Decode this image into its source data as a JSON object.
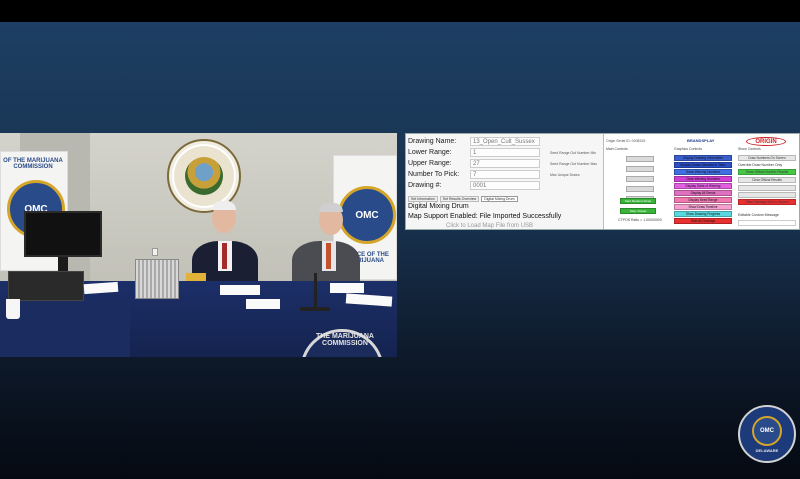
{
  "video": {
    "banner_left_label": "OMC",
    "banner_left_text": "OF THE MARIJUANA COMMISSION",
    "banner_right_label": "OMC",
    "banner_right_text": "OFFICE OF THE MARIJUANA",
    "skirt_text": "THE MARIJUANA COMMISSION"
  },
  "app": {
    "fields": [
      {
        "label": "Drawing Name:",
        "value": "13_Open_Cult_Sussex"
      },
      {
        "label": "Lower Range:",
        "value": "1"
      },
      {
        "label": "Upper Range:",
        "value": "27"
      },
      {
        "label": "Number To Pick:",
        "value": "7"
      },
      {
        "label": "Drawing #:",
        "value": "0001"
      }
    ],
    "side_notes": [
      "Seed Range Out Number Min",
      "Seed Range Out Number Max",
      "Max Unique Draws"
    ],
    "tabs": [
      "Set Information",
      "Set Results Overview",
      "Digital Mixing Drum"
    ],
    "drum_title": "Digital Mixing Drum",
    "map_status": "Map Support Enabled: File Imported Successfully",
    "load_map": "Click to Load Map File from USB",
    "origin_top": "Origin Serial ID: 0008315",
    "brand": "BRANDSPLAY",
    "origin_logo": "ORIGIN",
    "col_heads": [
      "Main Controls",
      "Graphics Controls",
      "Show Controls"
    ],
    "gray_buttons": [
      "",
      "",
      "",
      "",
      ""
    ],
    "green_buttons": [
      "Start Random Draw",
      "Stop / Reset"
    ],
    "status": "CTPOS Ratio = 1.00000000",
    "color_buttons": [
      {
        "label": "Display Drawing Information",
        "color": "#3a5fcd"
      },
      {
        "label": "Display Draws Selected in Table",
        "color": "#2a4fc8"
      },
      {
        "label": "Show Winning Numbers",
        "color": "#3f6fe0"
      },
      {
        "label": "Clear Winning Numbers",
        "color": "#d040d0"
      },
      {
        "label": "Display Odds of Winning",
        "color": "#e060e0"
      },
      {
        "label": "Display All Seeds",
        "color": "#e070c0"
      },
      {
        "label": "Display Seed Range",
        "color": "#f07ab0"
      },
      {
        "label": "Show Draw Timeline",
        "color": "#f4a0d0"
      },
      {
        "label": "Show Drawing Progress",
        "color": "#5ad8e0"
      },
      {
        "label": "Hide All Overlays",
        "color": "#e83030"
      }
    ],
    "right_buttons": [
      {
        "label": "Draw Numbers On Screen",
        "color": "#e6e6e6"
      },
      {
        "label": "",
        "color": "#ffffff"
      },
      {
        "label": "Show Official Number Results",
        "color": "#46c846"
      },
      {
        "label": "Clear Official Results",
        "color": "#e6e6e6"
      },
      {
        "label": "",
        "color": "#e6e6e6"
      },
      {
        "label": "",
        "color": "#e6e6e6"
      },
      {
        "label": "",
        "color": "#e6e6e6"
      },
      {
        "label": "Clear Overlays Sent to Screen",
        "color": "#e83030"
      }
    ],
    "right_texts": [
      "Override Draw Number Only",
      "Editable Custom Message"
    ]
  },
  "badge": {
    "label": "OMC",
    "state": "DELAWARE"
  }
}
